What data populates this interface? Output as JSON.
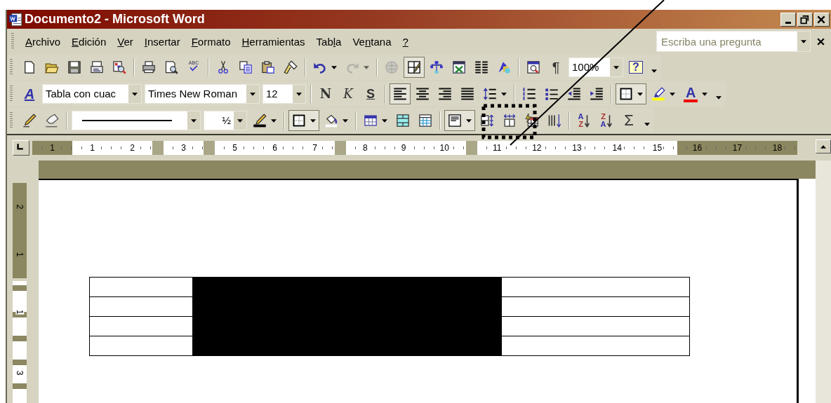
{
  "window": {
    "title": "Documento2 - Microsoft Word"
  },
  "menu": [
    {
      "key": "A",
      "post": "rchivo"
    },
    {
      "key": "E",
      "post": "dición"
    },
    {
      "key": "V",
      "post": "er"
    },
    {
      "key": "I",
      "post": "nsertar"
    },
    {
      "key": "F",
      "post": "ormato"
    },
    {
      "key": "H",
      "post": "erramientas"
    },
    {
      "pre": "Tab",
      "key": "l",
      "post": "a"
    },
    {
      "pre": "Ve",
      "key": "n",
      "post": "tana"
    },
    {
      "key": "?"
    }
  ],
  "help_box": {
    "placeholder": "Escriba una pregunta"
  },
  "toolbars": [
    [
      [
        {
          "kind": "new",
          "pressed": false,
          "disabled": false
        },
        {
          "kind": "open",
          "pressed": false,
          "disabled": false
        },
        {
          "kind": "save",
          "pressed": false,
          "disabled": false
        },
        {
          "kind": "mail",
          "pressed": false,
          "disabled": false
        },
        {
          "kind": "research",
          "pressed": false,
          "disabled": false
        }
      ],
      [
        {
          "kind": "print",
          "pressed": false,
          "disabled": false
        },
        {
          "kind": "preview",
          "pressed": false,
          "disabled": false
        },
        {
          "kind": "spell",
          "glyph": "ABC",
          "pressed": false,
          "disabled": false
        }
      ],
      [
        {
          "kind": "cut",
          "pressed": false,
          "disabled": false
        },
        {
          "kind": "copy",
          "pressed": false,
          "disabled": false
        },
        {
          "kind": "paste",
          "pressed": false,
          "disabled": false
        },
        {
          "kind": "painter",
          "pressed": false,
          "disabled": false
        }
      ],
      [
        {
          "kind": "undo",
          "pressed": false,
          "disabled": false,
          "menu": true
        },
        {
          "kind": "redo",
          "pressed": false,
          "disabled": true,
          "menu": true
        }
      ],
      [
        {
          "kind": "globe",
          "pressed": false,
          "disabled": true
        },
        {
          "kind": "tables",
          "pressed": true,
          "disabled": false
        },
        {
          "kind": "tree",
          "pressed": false,
          "disabled": false
        },
        {
          "kind": "excel",
          "pressed": false,
          "disabled": false
        },
        {
          "kind": "columns",
          "pressed": false,
          "disabled": false
        },
        {
          "kind": "drawing",
          "pressed": false,
          "disabled": false
        }
      ],
      [
        {
          "kind": "docmap",
          "pressed": false,
          "disabled": false
        },
        {
          "kind": "pilcrow",
          "glyph": "¶",
          "pressed": false,
          "disabled": false
        },
        {
          "kind": "zoom-box",
          "value": "100%"
        },
        {
          "kind": "help",
          "glyph": "?",
          "pressed": false,
          "disabled": false
        }
      ]
    ],
    [
      [
        {
          "kind": "styles",
          "glyph": "A",
          "pressed": false,
          "disabled": false
        },
        {
          "kind": "style-box",
          "value": "Tabla con cuac"
        },
        {
          "kind": "font-box",
          "value": "Times New Roman"
        },
        {
          "kind": "size-box",
          "value": "12"
        }
      ],
      [
        {
          "kind": "bold",
          "glyph": "N",
          "pressed": false,
          "disabled": false
        },
        {
          "kind": "italic",
          "glyph": "K",
          "pressed": false,
          "disabled": false
        },
        {
          "kind": "underline",
          "glyph": "S",
          "pressed": false,
          "disabled": false
        }
      ],
      [
        {
          "kind": "left",
          "pressed": true,
          "disabled": false
        },
        {
          "kind": "center",
          "pressed": false,
          "disabled": false
        },
        {
          "kind": "right",
          "pressed": false,
          "disabled": false
        },
        {
          "kind": "justify",
          "pressed": false,
          "disabled": false
        },
        {
          "kind": "spacing",
          "pressed": false,
          "disabled": false,
          "menu": true
        }
      ],
      [
        {
          "kind": "numbering",
          "pressed": false,
          "disabled": false
        },
        {
          "kind": "bullets",
          "pressed": false,
          "disabled": false
        },
        {
          "kind": "outdent",
          "pressed": false,
          "disabled": false
        },
        {
          "kind": "indent",
          "pressed": false,
          "disabled": false
        }
      ],
      [
        {
          "kind": "borders",
          "pressed": true,
          "disabled": false,
          "menu": true
        },
        {
          "kind": "highlight",
          "pressed": false,
          "disabled": false,
          "menu": true
        },
        {
          "kind": "fontcolor",
          "glyph": "A",
          "pressed": false,
          "disabled": false,
          "menu": true
        }
      ]
    ],
    [
      [
        {
          "kind": "pencil",
          "pressed": false,
          "disabled": false
        },
        {
          "kind": "eraser",
          "pressed": false,
          "disabled": false
        }
      ],
      [
        {
          "kind": "line-box"
        },
        {
          "kind": "weight-box",
          "value": "½"
        },
        {
          "kind": "bordercolor",
          "pressed": false,
          "disabled": false,
          "menu": true
        }
      ],
      [
        {
          "kind": "borders",
          "pressed": true,
          "disabled": false,
          "menu": true
        },
        {
          "kind": "shading",
          "pressed": false,
          "disabled": false,
          "menu": true
        }
      ],
      [
        {
          "kind": "inserttable",
          "pressed": false,
          "disabled": false,
          "menu": true
        },
        {
          "kind": "merge",
          "pressed": false,
          "disabled": false
        },
        {
          "kind": "split",
          "pressed": false,
          "disabled": false
        }
      ],
      [
        {
          "kind": "textalign",
          "pressed": true,
          "disabled": false,
          "menu": true
        },
        {
          "kind": "distrows",
          "pressed": false,
          "disabled": false
        },
        {
          "kind": "distcols",
          "pressed": false,
          "disabled": false
        },
        {
          "kind": "autoformat",
          "pressed": false,
          "disabled": false
        },
        {
          "kind": "textdir",
          "pressed": false,
          "disabled": false
        }
      ],
      [
        {
          "kind": "sortasc",
          "top": "A",
          "bottom": "Z",
          "pressed": false,
          "disabled": false
        },
        {
          "kind": "sortdesc",
          "top": "Z",
          "bottom": "A",
          "pressed": false,
          "disabled": false
        },
        {
          "kind": "sum",
          "glyph": "Σ",
          "pressed": false,
          "disabled": false
        }
      ]
    ]
  ],
  "ruler": [
    {
      "kind": "margin",
      "labels": [
        "1"
      ]
    },
    {
      "kind": "text",
      "labels": [
        "1",
        "2"
      ]
    },
    {
      "kind": "marker"
    },
    {
      "kind": "text",
      "labels": [
        "3"
      ]
    },
    {
      "kind": "marker"
    },
    {
      "kind": "text",
      "labels": [
        "5",
        "6",
        "7"
      ]
    },
    {
      "kind": "marker"
    },
    {
      "kind": "text",
      "labels": [
        "8",
        "9",
        "10"
      ]
    },
    {
      "kind": "marker"
    },
    {
      "kind": "text",
      "labels": [
        "11",
        "12",
        "13",
        "14",
        "15"
      ]
    },
    {
      "kind": "margin",
      "labels": [
        "16",
        "17",
        "18"
      ]
    }
  ],
  "vertical_ruler": [
    {
      "kind": "margin",
      "labels": [
        "2",
        "1"
      ]
    },
    {
      "kind": "text",
      "labels": [
        "1",
        "3"
      ]
    }
  ],
  "table": {
    "rows": [
      {
        "cells": [
          {
            "selected": false
          },
          {
            "selected": true
          },
          {
            "selected": true
          },
          {
            "selected": false
          }
        ]
      },
      {
        "cells": [
          {
            "selected": false
          },
          {
            "selected": true
          },
          {
            "selected": true
          },
          {
            "selected": false
          }
        ]
      },
      {
        "cells": [
          {
            "selected": false
          },
          {
            "selected": true
          },
          {
            "selected": true
          },
          {
            "selected": false
          }
        ]
      },
      {
        "cells": [
          {
            "selected": false
          },
          {
            "selected": true
          },
          {
            "selected": true
          },
          {
            "selected": false
          }
        ]
      }
    ]
  }
}
